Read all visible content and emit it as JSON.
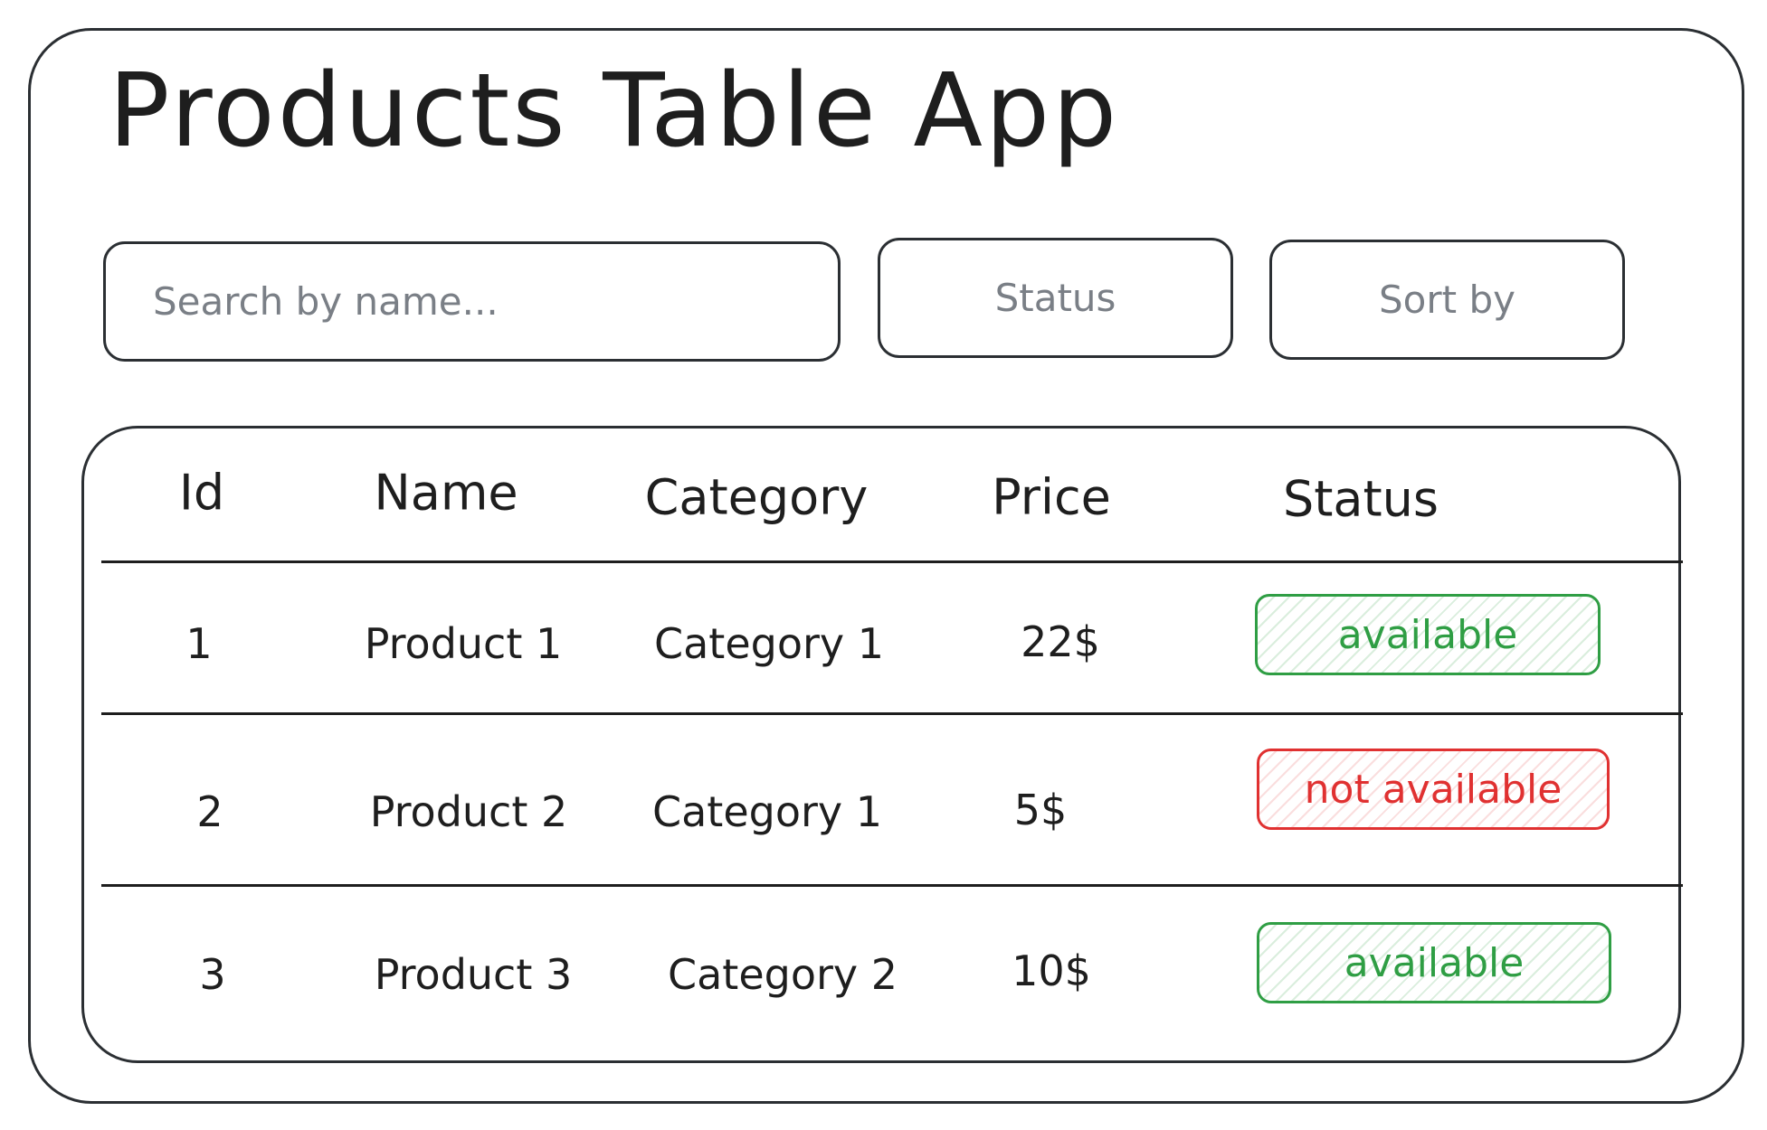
{
  "app": {
    "title": "Products Table App"
  },
  "controls": {
    "search_placeholder": "Search by name...",
    "status_label": "Status",
    "sort_label": "Sort by"
  },
  "table": {
    "columns": [
      "Id",
      "Name",
      "Category",
      "Price",
      "Status"
    ],
    "rows": [
      {
        "id": "1",
        "name": "Product 1",
        "category": "Category 1",
        "price": "22$",
        "status": "available"
      },
      {
        "id": "2",
        "name": "Product 2",
        "category": "Category 1",
        "price": "5$",
        "status": "not available"
      },
      {
        "id": "3",
        "name": "Product 3",
        "category": "Category 2",
        "price": "10$",
        "status": "available"
      }
    ]
  },
  "colors": {
    "available": "#2f9e44",
    "not_available": "#e03131",
    "outline": "#2b2f33",
    "placeholder": "#7a7f86"
  }
}
